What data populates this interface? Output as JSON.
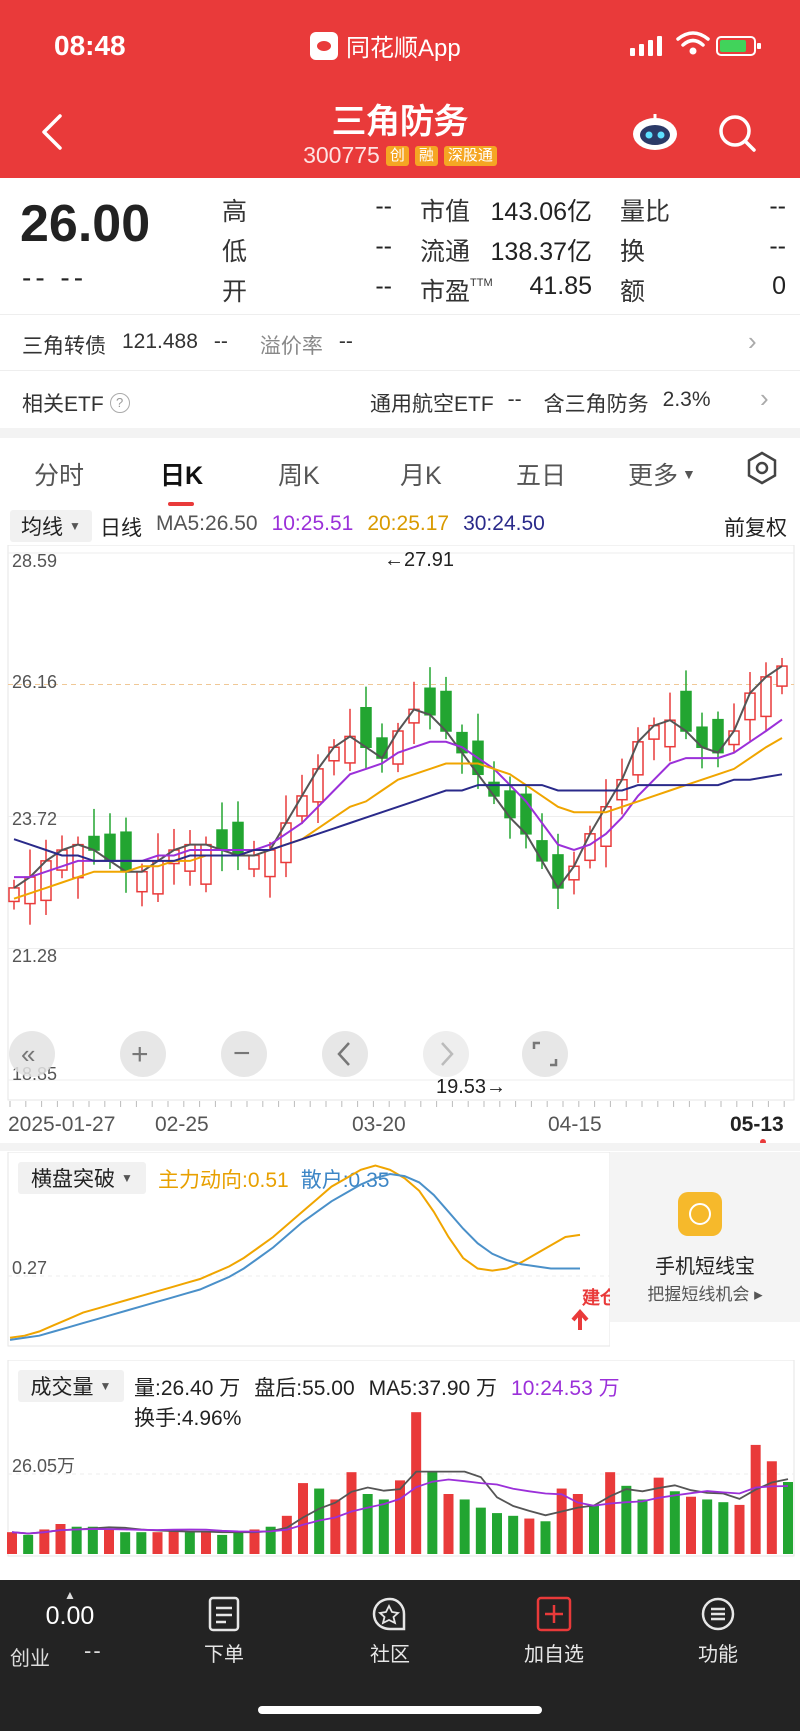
{
  "status_bar": {
    "time": "08:48",
    "app_name": "同花顺App"
  },
  "header": {
    "title": "三角防务",
    "code": "300775",
    "tags": [
      {
        "label": "创",
        "color": "#f5a623"
      },
      {
        "label": "融",
        "color": "#f5a623"
      },
      {
        "label": "深股通",
        "color": "#f5a623"
      }
    ]
  },
  "quote": {
    "price": "26.00",
    "change": "-- --",
    "fields": [
      {
        "label": "高",
        "value": "--"
      },
      {
        "label": "低",
        "value": "--"
      },
      {
        "label": "开",
        "value": "--"
      },
      {
        "label": "市值",
        "value": "143.06亿"
      },
      {
        "label": "流通",
        "value": "138.37亿"
      },
      {
        "label": "市盈",
        "sup": "TTM",
        "value": "41.85"
      },
      {
        "label": "量比",
        "value": "--"
      },
      {
        "label": "换",
        "value": "--"
      },
      {
        "label": "额",
        "value": "0"
      }
    ]
  },
  "bond": {
    "name": "三角转债",
    "price": "121.488",
    "change": "--",
    "premium_label": "溢价率",
    "premium_value": "--"
  },
  "etf": {
    "label": "相关ETF",
    "name": "通用航空ETF",
    "change": "--",
    "holding_label": "含三角防务",
    "holding_value": "2.3%"
  },
  "tabs": [
    {
      "label": "分时"
    },
    {
      "label": "日K"
    },
    {
      "label": "周K"
    },
    {
      "label": "月K"
    },
    {
      "label": "五日"
    },
    {
      "label": "更多"
    }
  ],
  "kline_legend": {
    "selector": "均线",
    "period": "日线",
    "ma5": "MA5:26.50",
    "ma10": "10:25.51",
    "ma20": "20:25.17",
    "ma30": "30:24.50",
    "adjust": "前复权"
  },
  "kline_axis": {
    "y_ticks": [
      "28.59",
      "26.16",
      "23.72",
      "21.28",
      "18.85"
    ],
    "high_note": "←27.91",
    "low_note": "19.53→"
  },
  "date_axis": [
    "2025-01-27",
    "02-25",
    "03-20",
    "04-15",
    "05-13"
  ],
  "indicator": {
    "selector": "横盘突破",
    "main": "主力动向:0.51",
    "retail": "散户:0.35",
    "y_tick": "0.27",
    "signal": "建仓"
  },
  "promo": {
    "title": "手机短线宝",
    "subtitle": "把握短线机会"
  },
  "volume": {
    "selector": "成交量",
    "vol": "量:26.40 万",
    "after": "盘后:55.00",
    "ma5": "MA5:37.90 万",
    "ma10": "10:24.53 万",
    "turnover": "换手:4.96%",
    "y_tick": "26.05万"
  },
  "bottom_nav": {
    "index_value": "0.00",
    "index_name": "创业",
    "index_change": "--",
    "items": [
      {
        "label": "下单"
      },
      {
        "label": "社区"
      },
      {
        "label": "加自选"
      },
      {
        "label": "功能"
      }
    ]
  },
  "colors": {
    "up": "#e93a3a",
    "down": "#22a531",
    "ma5": "#555555",
    "ma10": "#9b30d9",
    "ma20": "#f0a500",
    "ma30": "#2a2a8a",
    "main_force": "#f0a500",
    "retail_line": "#4a90c9"
  },
  "chart_data": [
    {
      "type": "candlestick",
      "title": "日线",
      "ylim": [
        18.85,
        28.59
      ],
      "y_ticks": [
        28.59,
        26.16,
        23.72,
        21.28,
        18.85
      ],
      "x_labels": [
        "2025-01-27",
        "02-25",
        "03-20",
        "04-15",
        "05-13"
      ],
      "annotations": [
        {
          "text": "←27.91",
          "value": 27.91
        },
        {
          "text": "19.53→",
          "value": 19.53
        }
      ],
      "series": [
        {
          "name": "MA5",
          "values": [
            22.4,
            22.6,
            22.9,
            23.1,
            23.2,
            23.1,
            22.9,
            22.7,
            22.7,
            22.9,
            23.1,
            23.2,
            23.2,
            23.1,
            23.0,
            23.0,
            23.1,
            23.6,
            24.1,
            24.6,
            25.0,
            25.2,
            25.0,
            24.8,
            25.3,
            25.7,
            25.6,
            25.3,
            24.9,
            24.5,
            24.1,
            23.7,
            23.4,
            22.9,
            22.4,
            22.8,
            23.4,
            23.9,
            24.4,
            25.1,
            25.4,
            25.5,
            25.3,
            25.0,
            24.9,
            25.3,
            26.0,
            26.3,
            26.5
          ]
        },
        {
          "name": "MA10",
          "values": [
            22.6,
            22.6,
            22.7,
            22.8,
            22.9,
            22.9,
            22.9,
            22.9,
            22.9,
            23.0,
            23.0,
            23.1,
            23.1,
            23.1,
            23.1,
            23.1,
            23.2,
            23.4,
            23.6,
            23.9,
            24.2,
            24.5,
            24.6,
            24.7,
            24.9,
            25.0,
            25.1,
            25.1,
            25.0,
            24.8,
            24.6,
            24.3,
            24.0,
            23.6,
            23.2,
            23.1,
            23.2,
            23.4,
            23.7,
            24.1,
            24.4,
            24.7,
            24.8,
            24.8,
            24.8,
            24.9,
            25.1,
            25.3,
            25.51
          ]
        },
        {
          "name": "MA20",
          "values": [
            22.2,
            22.3,
            22.4,
            22.5,
            22.6,
            22.7,
            22.7,
            22.7,
            22.8,
            22.8,
            22.9,
            22.9,
            23.0,
            23.0,
            23.0,
            23.1,
            23.1,
            23.2,
            23.3,
            23.5,
            23.7,
            23.9,
            24.0,
            24.2,
            24.4,
            24.5,
            24.6,
            24.7,
            24.7,
            24.7,
            24.6,
            24.5,
            24.3,
            24.1,
            23.9,
            23.8,
            23.8,
            23.8,
            23.9,
            24.0,
            24.1,
            24.2,
            24.3,
            24.4,
            24.5,
            24.6,
            24.8,
            25.0,
            25.17
          ]
        },
        {
          "name": "MA30",
          "values": [
            23.3,
            23.2,
            23.1,
            23.0,
            23.0,
            22.9,
            22.9,
            22.9,
            22.9,
            22.9,
            22.9,
            23.0,
            23.0,
            23.0,
            23.0,
            23.1,
            23.1,
            23.2,
            23.3,
            23.4,
            23.5,
            23.6,
            23.7,
            23.8,
            23.9,
            24.0,
            24.1,
            24.2,
            24.2,
            24.3,
            24.3,
            24.3,
            24.3,
            24.3,
            24.2,
            24.2,
            24.2,
            24.2,
            24.2,
            24.3,
            24.3,
            24.3,
            24.3,
            24.3,
            24.3,
            24.4,
            24.4,
            24.45,
            24.5
          ]
        }
      ]
    },
    {
      "type": "line",
      "title": "横盘突破",
      "y_ticks": [
        0.27
      ],
      "series": [
        {
          "name": "主力动向",
          "values": [
            0.02,
            0.03,
            0.05,
            0.08,
            0.11,
            0.14,
            0.16,
            0.18,
            0.2,
            0.22,
            0.24,
            0.26,
            0.28,
            0.3,
            0.33,
            0.36,
            0.4,
            0.45,
            0.5,
            0.56,
            0.62,
            0.68,
            0.74,
            0.78,
            0.82,
            0.84,
            0.82,
            0.78,
            0.72,
            0.62,
            0.5,
            0.4,
            0.35,
            0.34,
            0.35,
            0.38,
            0.42,
            0.46,
            0.5,
            0.51
          ]
        },
        {
          "name": "散户",
          "values": [
            0.01,
            0.02,
            0.03,
            0.05,
            0.07,
            0.09,
            0.11,
            0.13,
            0.15,
            0.17,
            0.19,
            0.21,
            0.23,
            0.25,
            0.28,
            0.31,
            0.35,
            0.4,
            0.45,
            0.51,
            0.57,
            0.62,
            0.67,
            0.71,
            0.75,
            0.78,
            0.8,
            0.79,
            0.76,
            0.7,
            0.62,
            0.54,
            0.47,
            0.42,
            0.39,
            0.37,
            0.36,
            0.35,
            0.35,
            0.35
          ]
        }
      ]
    },
    {
      "type": "bar",
      "title": "成交量",
      "y_ticks": [
        "26.05万"
      ],
      "series": [
        {
          "name": "量",
          "values": [
            8,
            7,
            9,
            11,
            10,
            10,
            9,
            8,
            8,
            8,
            9,
            8,
            8,
            7,
            8,
            9,
            10,
            14,
            26,
            24,
            20,
            30,
            22,
            20,
            27,
            52,
            30,
            22,
            20,
            17,
            15,
            14,
            13,
            12,
            24,
            22,
            18,
            30,
            25,
            20,
            28,
            23,
            21,
            20,
            19,
            18,
            40,
            34,
            26.4
          ]
        }
      ],
      "up_flags": [
        1,
        0,
        1,
        1,
        0,
        0,
        1,
        0,
        0,
        1,
        1,
        0,
        1,
        0,
        0,
        1,
        0,
        1,
        1,
        0,
        1,
        1,
        0,
        0,
        1,
        1,
        0,
        1,
        0,
        0,
        0,
        0,
        1,
        0,
        1,
        1,
        0,
        1,
        0,
        0,
        1,
        0,
        1,
        0,
        0,
        1,
        1,
        1,
        0
      ]
    }
  ]
}
